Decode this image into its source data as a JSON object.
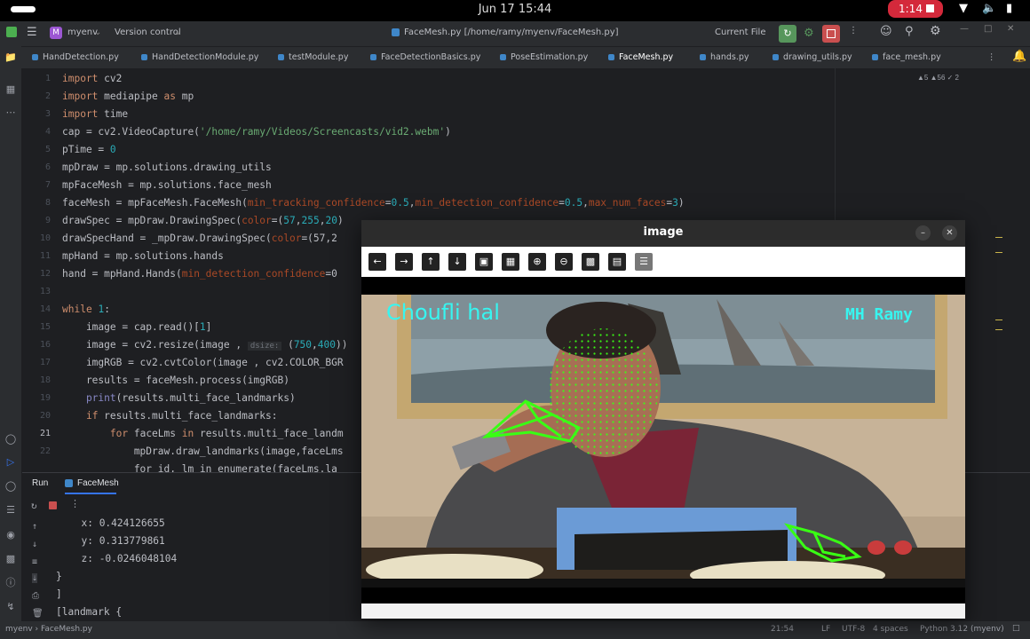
{
  "system": {
    "clock": "Jun 17  15:44",
    "recording": "1:14"
  },
  "toolbar": {
    "project_badge": "M",
    "project": "myenv",
    "vcs": "Version control",
    "file_path": "FaceMesh.py [/home/ramy/myenv/FaceMesh.py]",
    "run_config": "Current File"
  },
  "tabs": [
    "HandDetection.py",
    "HandDetectionModule.py",
    "testModule.py",
    "FaceDetectionBasics.py",
    "PoseEstimation.py",
    "FaceMesh.py",
    "hands.py",
    "drawing_utils.py",
    "face_mesh.py"
  ],
  "inspections": "▲5 ▲56 ✓ 2",
  "line_numbers": [
    "1",
    "2",
    "3",
    "4",
    "5",
    "6",
    "7",
    "8",
    "9",
    "10",
    "11",
    "12",
    "13",
    "14",
    "15",
    "16",
    "17",
    "18",
    "19",
    "20",
    "21",
    "22"
  ],
  "code": {
    "l1": [
      "import",
      " cv2"
    ],
    "l2": [
      "import",
      " mediapipe ",
      "as",
      " mp"
    ],
    "l3": [
      "import",
      " time"
    ],
    "l4": [
      "cap = cv2.VideoCapture(",
      "'/home/ramy/Videos/Screencasts/vid2.webm'",
      ")"
    ],
    "l5": [
      "pTime = ",
      "0"
    ],
    "l6": "mpDraw = mp.solutions.drawing_utils",
    "l7": "mpFaceMesh = mp.solutions.face_mesh",
    "l8": [
      "faceMesh = mpFaceMesh.FaceMesh(",
      "min_tracking_confidence",
      "=",
      "0.5",
      ",",
      "min_detection_confidence",
      "=",
      "0.5",
      ",",
      "max_num_faces",
      "=",
      "3",
      ")"
    ],
    "l9": [
      "drawSpec = mpDraw.DrawingSpec(",
      "color",
      "=(",
      "57",
      ",",
      "255",
      ",",
      "20",
      ")"
    ],
    "l10": [
      "drawSpecHand = _mpDraw.DrawingSpec(",
      "color",
      "=(57,2"
    ],
    "l11": "mpHand = mp.solutions.hands",
    "l12": [
      "hand = mpHand.Hands(",
      "min_detection_confidence",
      "=0"
    ],
    "l14": [
      "while",
      " ",
      "1",
      ":"
    ],
    "l15": [
      "    image = cap.read()[",
      "1",
      "]"
    ],
    "l16": [
      "    image = cv2.resize(image , ",
      "dsize:",
      " (",
      "750",
      ",",
      "400",
      "))"
    ],
    "l17": "    imgRGB = cv2.cvtColor(image , cv2.COLOR_BGR",
    "l18": "    results = faceMesh.process(imgRGB)",
    "l19": [
      "    ",
      "print",
      "(results.multi_face_landmarks)"
    ],
    "l20": [
      "    ",
      "if",
      " results.multi_face_landmarks:"
    ],
    "l21": [
      "        ",
      "for",
      " faceLms ",
      "in",
      " results.multi_face_landm"
    ],
    "l22": "            mpDraw.draw_landmarks(image,faceLms",
    "l23": "            for id, lm in enumerate(faceLms.la"
  },
  "run_panel": {
    "tab_run": "Run",
    "tab_file": "FaceMesh",
    "lines": [
      "x: 0.424126655",
      "y: 0.313779861",
      "z: -0.0246048104",
      "}",
      "]",
      "[landmark {"
    ]
  },
  "statusbar": {
    "left": "myenv  ›  FaceMesh.py",
    "pos": "21:54",
    "eol": "LF",
    "encoding": "UTF-8",
    "indent": "4 spaces",
    "interpreter": "Python 3.12 (myenv)"
  },
  "image_window": {
    "title": "image",
    "overlay_left": "Choufli hal",
    "overlay_right": "MH Ramy"
  },
  "icons": {
    "tools": [
      "arrow-left-icon",
      "arrow-right-icon",
      "arrow-up-icon",
      "arrow-down-icon",
      "image-icon",
      "image-save-icon",
      "zoom-in-icon",
      "zoom-out-icon",
      "save-icon",
      "copy-icon",
      "properties-icon"
    ]
  },
  "colors": {
    "accent": "#3574f0",
    "rec": "#d4293b",
    "landmarks": "#39ff14",
    "overlay_text": "#37f5f0"
  }
}
